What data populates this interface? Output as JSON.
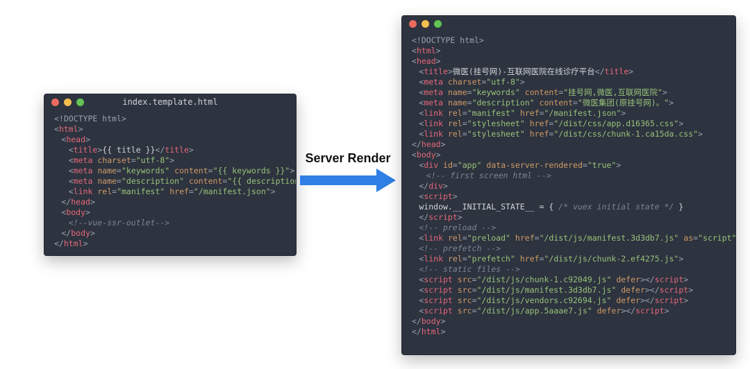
{
  "label": "Server Render",
  "left": {
    "title": "index.template.html",
    "lines": [
      [
        {
          "c": "pun",
          "t": "<!DOCTYPE html>"
        }
      ],
      [
        {
          "c": "pun",
          "t": "<"
        },
        {
          "c": "tag",
          "t": "html"
        },
        {
          "c": "pun",
          "t": ">"
        }
      ],
      [
        {
          "c": "pun",
          "t": "<"
        },
        {
          "c": "tag",
          "t": "head"
        },
        {
          "c": "pun",
          "t": ">"
        }
      ],
      [
        {
          "c": "pun",
          "t": "<"
        },
        {
          "c": "tag",
          "t": "title"
        },
        {
          "c": "pun",
          "t": ">"
        },
        {
          "c": "txt",
          "t": "{{ title }}"
        },
        {
          "c": "pun",
          "t": "</"
        },
        {
          "c": "tag",
          "t": "title"
        },
        {
          "c": "pun",
          "t": ">"
        }
      ],
      [
        {
          "c": "pun",
          "t": "<"
        },
        {
          "c": "tag",
          "t": "meta"
        },
        {
          "c": "pun",
          "t": " "
        },
        {
          "c": "attr",
          "t": "charset"
        },
        {
          "c": "pun",
          "t": "="
        },
        {
          "c": "str",
          "t": "\"utf-8\""
        },
        {
          "c": "pun",
          "t": ">"
        }
      ],
      [
        {
          "c": "pun",
          "t": "<"
        },
        {
          "c": "tag",
          "t": "meta"
        },
        {
          "c": "pun",
          "t": " "
        },
        {
          "c": "attr",
          "t": "name"
        },
        {
          "c": "pun",
          "t": "="
        },
        {
          "c": "str",
          "t": "\"keywords\""
        },
        {
          "c": "pun",
          "t": " "
        },
        {
          "c": "attr",
          "t": "content"
        },
        {
          "c": "pun",
          "t": "="
        },
        {
          "c": "str",
          "t": "\"{{ keywords }}\""
        },
        {
          "c": "pun",
          "t": ">"
        }
      ],
      [
        {
          "c": "pun",
          "t": "<"
        },
        {
          "c": "tag",
          "t": "meta"
        },
        {
          "c": "pun",
          "t": " "
        },
        {
          "c": "attr",
          "t": "name"
        },
        {
          "c": "pun",
          "t": "="
        },
        {
          "c": "str",
          "t": "\"description\""
        },
        {
          "c": "pun",
          "t": " "
        },
        {
          "c": "attr",
          "t": "content"
        },
        {
          "c": "pun",
          "t": "="
        },
        {
          "c": "str",
          "t": "\"{{ description }}\""
        },
        {
          "c": "pun",
          "t": ">"
        }
      ],
      [
        {
          "c": "pun",
          "t": "<"
        },
        {
          "c": "tag",
          "t": "link"
        },
        {
          "c": "pun",
          "t": " "
        },
        {
          "c": "attr",
          "t": "rel"
        },
        {
          "c": "pun",
          "t": "="
        },
        {
          "c": "str",
          "t": "\"manifest\""
        },
        {
          "c": "pun",
          "t": " "
        },
        {
          "c": "attr",
          "t": "href"
        },
        {
          "c": "pun",
          "t": "="
        },
        {
          "c": "str",
          "t": "\"/manifest.json\""
        },
        {
          "c": "pun",
          "t": ">"
        }
      ],
      [
        {
          "c": "pun",
          "t": "</"
        },
        {
          "c": "tag",
          "t": "head"
        },
        {
          "c": "pun",
          "t": ">"
        }
      ],
      [
        {
          "c": "pun",
          "t": "<"
        },
        {
          "c": "tag",
          "t": "body"
        },
        {
          "c": "pun",
          "t": ">"
        }
      ],
      [
        {
          "c": "com",
          "t": "<!--vue-ssr-outlet-->"
        }
      ],
      [
        {
          "c": "pun",
          "t": "</"
        },
        {
          "c": "tag",
          "t": "body"
        },
        {
          "c": "pun",
          "t": ">"
        }
      ],
      [
        {
          "c": "pun",
          "t": "</"
        },
        {
          "c": "tag",
          "t": "html"
        },
        {
          "c": "pun",
          "t": ">"
        }
      ]
    ],
    "indents": [
      0,
      0,
      1,
      2,
      2,
      2,
      2,
      2,
      1,
      1,
      2,
      1,
      0
    ]
  },
  "right": {
    "title": "",
    "lines": [
      [
        {
          "c": "pun",
          "t": "<!DOCTYPE html>"
        }
      ],
      [
        {
          "c": "pun",
          "t": "<"
        },
        {
          "c": "tag",
          "t": "html"
        },
        {
          "c": "pun",
          "t": ">"
        }
      ],
      [
        {
          "c": "pun",
          "t": "<"
        },
        {
          "c": "tag",
          "t": "head"
        },
        {
          "c": "pun",
          "t": ">"
        }
      ],
      [
        {
          "c": "pun",
          "t": "<"
        },
        {
          "c": "tag",
          "t": "title"
        },
        {
          "c": "pun",
          "t": ">"
        },
        {
          "c": "txt",
          "t": "微医(挂号网)-互联网医院在线诊疗平台"
        },
        {
          "c": "pun",
          "t": "</"
        },
        {
          "c": "tag",
          "t": "title"
        },
        {
          "c": "pun",
          "t": ">"
        }
      ],
      [
        {
          "c": "pun",
          "t": "<"
        },
        {
          "c": "tag",
          "t": "meta"
        },
        {
          "c": "pun",
          "t": " "
        },
        {
          "c": "attr",
          "t": "charset"
        },
        {
          "c": "pun",
          "t": "="
        },
        {
          "c": "str",
          "t": "\"utf-8\""
        },
        {
          "c": "pun",
          "t": ">"
        }
      ],
      [
        {
          "c": "pun",
          "t": "<"
        },
        {
          "c": "tag",
          "t": "meta"
        },
        {
          "c": "pun",
          "t": " "
        },
        {
          "c": "attr",
          "t": "name"
        },
        {
          "c": "pun",
          "t": "="
        },
        {
          "c": "str",
          "t": "\"keywords\""
        },
        {
          "c": "pun",
          "t": " "
        },
        {
          "c": "attr",
          "t": "content"
        },
        {
          "c": "pun",
          "t": "="
        },
        {
          "c": "str",
          "t": "\"挂号网,微医,互联网医院\""
        },
        {
          "c": "pun",
          "t": ">"
        }
      ],
      [
        {
          "c": "pun",
          "t": "<"
        },
        {
          "c": "tag",
          "t": "meta"
        },
        {
          "c": "pun",
          "t": " "
        },
        {
          "c": "attr",
          "t": "name"
        },
        {
          "c": "pun",
          "t": "="
        },
        {
          "c": "str",
          "t": "\"description\""
        },
        {
          "c": "pun",
          "t": " "
        },
        {
          "c": "attr",
          "t": "content"
        },
        {
          "c": "pun",
          "t": "="
        },
        {
          "c": "str",
          "t": "\"微医集团(原挂号网)。\""
        },
        {
          "c": "pun",
          "t": ">"
        }
      ],
      [
        {
          "c": "pun",
          "t": "<"
        },
        {
          "c": "tag",
          "t": "link"
        },
        {
          "c": "pun",
          "t": " "
        },
        {
          "c": "attr",
          "t": "rel"
        },
        {
          "c": "pun",
          "t": "="
        },
        {
          "c": "str",
          "t": "\"manifest\""
        },
        {
          "c": "pun",
          "t": " "
        },
        {
          "c": "attr",
          "t": "href"
        },
        {
          "c": "pun",
          "t": "="
        },
        {
          "c": "str",
          "t": "\"/manifest.json\""
        },
        {
          "c": "pun",
          "t": ">"
        }
      ],
      [
        {
          "c": "pun",
          "t": "<"
        },
        {
          "c": "tag",
          "t": "link"
        },
        {
          "c": "pun",
          "t": " "
        },
        {
          "c": "attr",
          "t": "rel"
        },
        {
          "c": "pun",
          "t": "="
        },
        {
          "c": "str",
          "t": "\"stylesheet\""
        },
        {
          "c": "pun",
          "t": " "
        },
        {
          "c": "attr",
          "t": "href"
        },
        {
          "c": "pun",
          "t": "="
        },
        {
          "c": "str",
          "t": "\"/dist/css/app.d16365.css\""
        },
        {
          "c": "pun",
          "t": ">"
        }
      ],
      [
        {
          "c": "pun",
          "t": "<"
        },
        {
          "c": "tag",
          "t": "link"
        },
        {
          "c": "pun",
          "t": " "
        },
        {
          "c": "attr",
          "t": "rel"
        },
        {
          "c": "pun",
          "t": "="
        },
        {
          "c": "str",
          "t": "\"stylesheet\""
        },
        {
          "c": "pun",
          "t": " "
        },
        {
          "c": "attr",
          "t": "href"
        },
        {
          "c": "pun",
          "t": "="
        },
        {
          "c": "str",
          "t": "\"/dist/css/chunk-1.ca15da.css\""
        },
        {
          "c": "pun",
          "t": ">"
        }
      ],
      [
        {
          "c": "pun",
          "t": "</"
        },
        {
          "c": "tag",
          "t": "head"
        },
        {
          "c": "pun",
          "t": ">"
        }
      ],
      [
        {
          "c": "pun",
          "t": "<"
        },
        {
          "c": "tag",
          "t": "body"
        },
        {
          "c": "pun",
          "t": ">"
        }
      ],
      [
        {
          "c": "pun",
          "t": "<"
        },
        {
          "c": "tag",
          "t": "div"
        },
        {
          "c": "pun",
          "t": " "
        },
        {
          "c": "attr",
          "t": "id"
        },
        {
          "c": "pun",
          "t": "="
        },
        {
          "c": "str",
          "t": "\"app\""
        },
        {
          "c": "pun",
          "t": " "
        },
        {
          "c": "attr",
          "t": "data-server-rendered"
        },
        {
          "c": "pun",
          "t": "="
        },
        {
          "c": "str",
          "t": "\"true\""
        },
        {
          "c": "pun",
          "t": ">"
        }
      ],
      [
        {
          "c": "com",
          "t": "<!-- first screen html -->"
        }
      ],
      [
        {
          "c": "pun",
          "t": "</"
        },
        {
          "c": "tag",
          "t": "div"
        },
        {
          "c": "pun",
          "t": ">"
        }
      ],
      [
        {
          "c": "pun",
          "t": "<"
        },
        {
          "c": "tag",
          "t": "script"
        },
        {
          "c": "pun",
          "t": ">"
        }
      ],
      [
        {
          "c": "txt",
          "t": "window.__INITIAL_STATE__ = { "
        },
        {
          "c": "com",
          "t": "/* vuex initial state */"
        },
        {
          "c": "txt",
          "t": " }"
        }
      ],
      [
        {
          "c": "pun",
          "t": "</"
        },
        {
          "c": "tag",
          "t": "script"
        },
        {
          "c": "pun",
          "t": ">"
        }
      ],
      [
        {
          "c": "com",
          "t": "<!-- preload -->"
        }
      ],
      [
        {
          "c": "pun",
          "t": "<"
        },
        {
          "c": "tag",
          "t": "link"
        },
        {
          "c": "pun",
          "t": " "
        },
        {
          "c": "attr",
          "t": "rel"
        },
        {
          "c": "pun",
          "t": "="
        },
        {
          "c": "str",
          "t": "\"preload\""
        },
        {
          "c": "pun",
          "t": " "
        },
        {
          "c": "attr",
          "t": "href"
        },
        {
          "c": "pun",
          "t": "="
        },
        {
          "c": "str",
          "t": "\"/dist/js/manifest.3d3db7.js\""
        },
        {
          "c": "pun",
          "t": " "
        },
        {
          "c": "attr",
          "t": "as"
        },
        {
          "c": "pun",
          "t": "="
        },
        {
          "c": "str",
          "t": "\"script\""
        },
        {
          "c": "pun",
          "t": ">"
        }
      ],
      [
        {
          "c": "com",
          "t": "<!-- prefetch -->"
        }
      ],
      [
        {
          "c": "pun",
          "t": "<"
        },
        {
          "c": "tag",
          "t": "link"
        },
        {
          "c": "pun",
          "t": " "
        },
        {
          "c": "attr",
          "t": "rel"
        },
        {
          "c": "pun",
          "t": "="
        },
        {
          "c": "str",
          "t": "\"prefetch\""
        },
        {
          "c": "pun",
          "t": " "
        },
        {
          "c": "attr",
          "t": "href"
        },
        {
          "c": "pun",
          "t": "="
        },
        {
          "c": "str",
          "t": "\"/dist/js/chunk-2.ef4275.js\""
        },
        {
          "c": "pun",
          "t": ">"
        }
      ],
      [
        {
          "c": "com",
          "t": "<!-- static files -->"
        }
      ],
      [
        {
          "c": "pun",
          "t": "<"
        },
        {
          "c": "tag",
          "t": "script"
        },
        {
          "c": "pun",
          "t": " "
        },
        {
          "c": "attr",
          "t": "src"
        },
        {
          "c": "pun",
          "t": "="
        },
        {
          "c": "str",
          "t": "\"/dist/js/chunk-1.c92049.js\""
        },
        {
          "c": "pun",
          "t": " "
        },
        {
          "c": "attr",
          "t": "defer"
        },
        {
          "c": "pun",
          "t": "></"
        },
        {
          "c": "tag",
          "t": "script"
        },
        {
          "c": "pun",
          "t": ">"
        }
      ],
      [
        {
          "c": "pun",
          "t": "<"
        },
        {
          "c": "tag",
          "t": "script"
        },
        {
          "c": "pun",
          "t": " "
        },
        {
          "c": "attr",
          "t": "src"
        },
        {
          "c": "pun",
          "t": "="
        },
        {
          "c": "str",
          "t": "\"/dist/js/manifest.3d3db7.js\""
        },
        {
          "c": "pun",
          "t": " "
        },
        {
          "c": "attr",
          "t": "defer"
        },
        {
          "c": "pun",
          "t": "></"
        },
        {
          "c": "tag",
          "t": "script"
        },
        {
          "c": "pun",
          "t": ">"
        }
      ],
      [
        {
          "c": "pun",
          "t": "<"
        },
        {
          "c": "tag",
          "t": "script"
        },
        {
          "c": "pun",
          "t": " "
        },
        {
          "c": "attr",
          "t": "src"
        },
        {
          "c": "pun",
          "t": "="
        },
        {
          "c": "str",
          "t": "\"/dist/js/vendors.c92694.js\""
        },
        {
          "c": "pun",
          "t": " "
        },
        {
          "c": "attr",
          "t": "defer"
        },
        {
          "c": "pun",
          "t": "></"
        },
        {
          "c": "tag",
          "t": "script"
        },
        {
          "c": "pun",
          "t": ">"
        }
      ],
      [
        {
          "c": "pun",
          "t": "<"
        },
        {
          "c": "tag",
          "t": "script"
        },
        {
          "c": "pun",
          "t": " "
        },
        {
          "c": "attr",
          "t": "src"
        },
        {
          "c": "pun",
          "t": "="
        },
        {
          "c": "str",
          "t": "\"/dist/js/app.5aaae7.js\""
        },
        {
          "c": "pun",
          "t": " "
        },
        {
          "c": "attr",
          "t": "defer"
        },
        {
          "c": "pun",
          "t": "></"
        },
        {
          "c": "tag",
          "t": "script"
        },
        {
          "c": "pun",
          "t": ">"
        }
      ],
      [
        {
          "c": "pun",
          "t": "</"
        },
        {
          "c": "tag",
          "t": "body"
        },
        {
          "c": "pun",
          "t": ">"
        }
      ],
      [
        {
          "c": "pun",
          "t": "</"
        },
        {
          "c": "tag",
          "t": "html"
        },
        {
          "c": "pun",
          "t": ">"
        }
      ]
    ],
    "indents": [
      0,
      0,
      0,
      1,
      1,
      1,
      1,
      1,
      1,
      1,
      0,
      0,
      1,
      2,
      1,
      1,
      1,
      1,
      1,
      1,
      1,
      1,
      1,
      1,
      1,
      1,
      1,
      0,
      0
    ]
  }
}
